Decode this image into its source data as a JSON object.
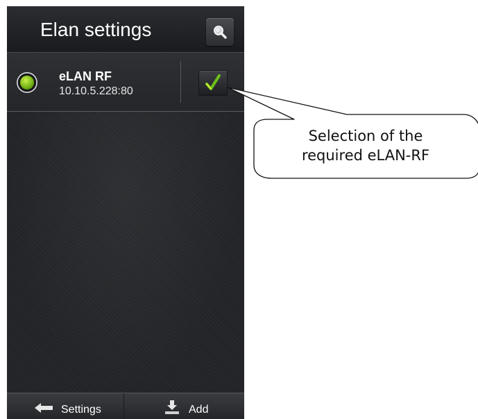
{
  "header": {
    "title": "Elan settings"
  },
  "device": {
    "name": "eLAN RF",
    "address": "10.10.5.228:80",
    "status_color": "#8fd11e",
    "selected": true
  },
  "footer": {
    "settings_label": "Settings",
    "add_label": "Add"
  },
  "callout": {
    "line1": "Selection of the",
    "line2": "required eLAN-RF"
  },
  "icons": {
    "search": "magnifier-icon",
    "select": "checkmark-icon",
    "settings": "left-arrow-icon",
    "add": "download-icon"
  }
}
